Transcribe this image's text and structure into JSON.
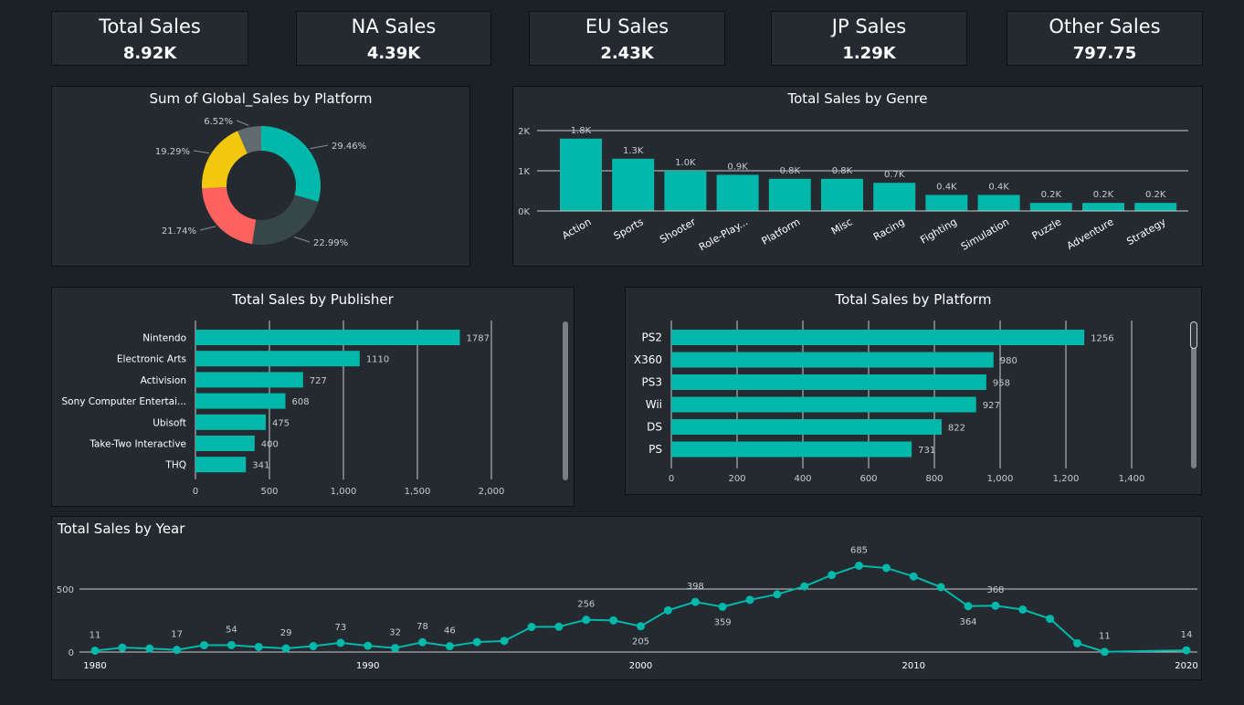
{
  "colors": {
    "background": "#1b2127",
    "card": "#242a30",
    "teal": "#01b8aa",
    "donut": [
      "#01b8aa",
      "#374649",
      "#fd625e",
      "#f2c80f",
      "#5f6b6d"
    ],
    "text": "#ffffff",
    "muted": "#c8ccd0",
    "grid": "#c8ccd0"
  },
  "kpis": [
    {
      "title": "Total Sales",
      "value": "8.92K"
    },
    {
      "title": "NA Sales",
      "value": "4.39K"
    },
    {
      "title": "EU Sales",
      "value": "2.43K"
    },
    {
      "title": "JP Sales",
      "value": "1.29K"
    },
    {
      "title": "Other Sales",
      "value": "797.75"
    }
  ],
  "chart_data": [
    {
      "type": "pie",
      "title": "Sum of Global_Sales by Platform",
      "slices": [
        29.46,
        22.99,
        21.74,
        19.29,
        6.52
      ],
      "labels": [
        "29.46%",
        "22.99%",
        "21.74%",
        "19.29%",
        "6.52%"
      ]
    },
    {
      "type": "bar",
      "title": "Total Sales by Genre",
      "categories": [
        "Action",
        "Sports",
        "Shooter",
        "Role-Play...",
        "Platform",
        "Misc",
        "Racing",
        "Fighting",
        "Simulation",
        "Puzzle",
        "Adventure",
        "Strategy"
      ],
      "values": [
        1.8,
        1.3,
        1.0,
        0.9,
        0.8,
        0.8,
        0.7,
        0.4,
        0.4,
        0.2,
        0.2,
        0.2
      ],
      "value_labels": [
        "1.8K",
        "1.3K",
        "1.0K",
        "0.9K",
        "0.8K",
        "0.8K",
        "0.7K",
        "0.4K",
        "0.4K",
        "0.2K",
        "0.2K",
        "0.2K"
      ],
      "yticks": [
        "0K",
        "1K",
        "2K"
      ],
      "ylim": [
        0,
        2
      ]
    },
    {
      "type": "bar",
      "orientation": "horizontal",
      "title": "Total Sales by Publisher",
      "categories": [
        "Nintendo",
        "Electronic Arts",
        "Activision",
        "Sony Computer Entertai...",
        "Ubisoft",
        "Take-Two Interactive",
        "THQ"
      ],
      "values": [
        1787,
        1110,
        727,
        608,
        475,
        400,
        341
      ],
      "value_labels": [
        "1787",
        "1110",
        "727",
        "608",
        "475",
        "400",
        "341"
      ],
      "xticks": [
        "0",
        "500",
        "1,000",
        "1,500",
        "2,000"
      ],
      "xlim": [
        0,
        2000
      ]
    },
    {
      "type": "bar",
      "orientation": "horizontal",
      "title": "Total Sales by Platform",
      "categories": [
        "PS2",
        "X360",
        "PS3",
        "Wii",
        "DS",
        "PS"
      ],
      "values": [
        1256,
        980,
        958,
        927,
        822,
        731
      ],
      "value_labels": [
        "1256",
        "980",
        "958",
        "927",
        "822",
        "731"
      ],
      "xticks": [
        "0",
        "200",
        "400",
        "600",
        "800",
        "1,000",
        "1,200",
        "1,400"
      ],
      "xlim": [
        0,
        1400
      ]
    },
    {
      "type": "line",
      "title": "Total Sales by Year",
      "x": [
        1980,
        1981,
        1982,
        1983,
        1984,
        1985,
        1986,
        1987,
        1988,
        1989,
        1990,
        1991,
        1992,
        1993,
        1994,
        1995,
        1996,
        1997,
        1998,
        1999,
        2000,
        2001,
        2002,
        2003,
        2004,
        2005,
        2006,
        2007,
        2008,
        2009,
        2010,
        2011,
        2012,
        2013,
        2014,
        2015,
        2016,
        2017,
        2020
      ],
      "y": [
        11,
        35,
        28,
        17,
        54,
        55,
        40,
        29,
        47,
        73,
        50,
        32,
        78,
        46,
        79,
        88,
        199,
        201,
        256,
        251,
        205,
        331,
        398,
        359,
        414,
        458,
        521,
        611,
        685,
        667,
        600,
        515,
        364,
        368,
        337,
        264,
        70,
        2,
        14
      ],
      "point_labels": [
        {
          "year": 1980,
          "text": "11"
        },
        {
          "year": 1983,
          "text": "17"
        },
        {
          "year": 1985,
          "text": "54"
        },
        {
          "year": 1987,
          "text": "29"
        },
        {
          "year": 1989,
          "text": "73"
        },
        {
          "year": 1991,
          "text": "32"
        },
        {
          "year": 1992,
          "text": "78"
        },
        {
          "year": 1993,
          "text": "46"
        },
        {
          "year": 1998,
          "text": "256"
        },
        {
          "year": 2000,
          "text": "205"
        },
        {
          "year": 2002,
          "text": "398"
        },
        {
          "year": 2003,
          "text": "359"
        },
        {
          "year": 2008,
          "text": "685"
        },
        {
          "year": 2012,
          "text": "364"
        },
        {
          "year": 2013,
          "text": "368"
        },
        {
          "year": 2017,
          "text": "11"
        },
        {
          "year": 2020,
          "text": "14"
        }
      ],
      "xticks": [
        "1980",
        "1990",
        "2000",
        "2010",
        "2020"
      ],
      "yticks": [
        "0",
        "500"
      ],
      "ylim": [
        0,
        750
      ]
    }
  ]
}
